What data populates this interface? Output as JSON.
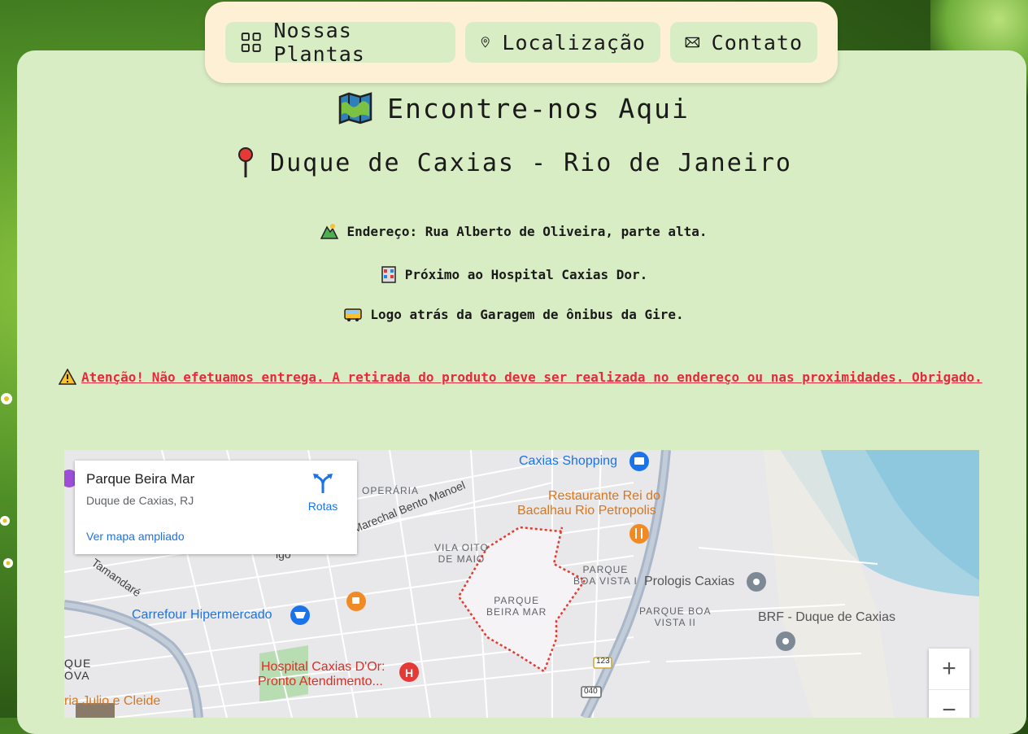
{
  "nav": {
    "items": [
      {
        "label": "Nossas Plantas",
        "icon": "grid-icon"
      },
      {
        "label": "Localização",
        "icon": "location-pin-icon"
      },
      {
        "label": "Contato",
        "icon": "envelope-icon"
      }
    ]
  },
  "main": {
    "title": "Encontre-nos Aqui",
    "subtitle": "Duque de Caxias - Rio de Janeiro",
    "address": "Endereço: Rua Alberto de Oliveira, parte alta.",
    "near": "Próximo ao Hospital Caxias Dor.",
    "behind": "Logo atrás da Garagem de ônibus da Gire.",
    "warning": "Atenção! Não efetuamos entrega. A retirada do produto deve ser realizada no endereço ou nas proximidades. Obrigado."
  },
  "map": {
    "place_name": "Parque Beira Mar",
    "place_region": "Duque de Caxias, RJ",
    "directions_label": "Rotas",
    "view_larger": "Ver mapa ampliado",
    "zoom_in": "+",
    "zoom_out": "−",
    "labels": {
      "caxias_shopping": "Caxias Shopping",
      "restaurante_1": "Restaurante Rei do",
      "restaurante_2": "Bacalhau Rio Petropolis",
      "operaria": "OPERÁRIA",
      "marechal": "Marechal Bento Manoel",
      "vila_oito_1": "VILA OITO",
      "vila_oito_2": "DE MAIO",
      "parque_bv1_1": "PARQUE",
      "parque_bv1_2": "BOA VISTA I",
      "prologis": "Prologis Caxias",
      "parque_bm_1": "PARQUE",
      "parque_bm_2": "BEIRA MAR",
      "parque_bv2_1": "PARQUE BOA",
      "parque_bv2_2": "VISTA II",
      "brf": "BRF - Duque de Caxias",
      "tamandare": "Tamandaré",
      "carrefour": "Carrefour Hipermercado",
      "hospital_1": "Hospital Caxias D'Or:",
      "hospital_2": "Pronto Atendimento...",
      "que": "QUE",
      "ova": "OVA",
      "julio": "ria Julio e Cleide",
      "road_123": "123",
      "road_040": "040",
      "igo": "igo"
    }
  }
}
